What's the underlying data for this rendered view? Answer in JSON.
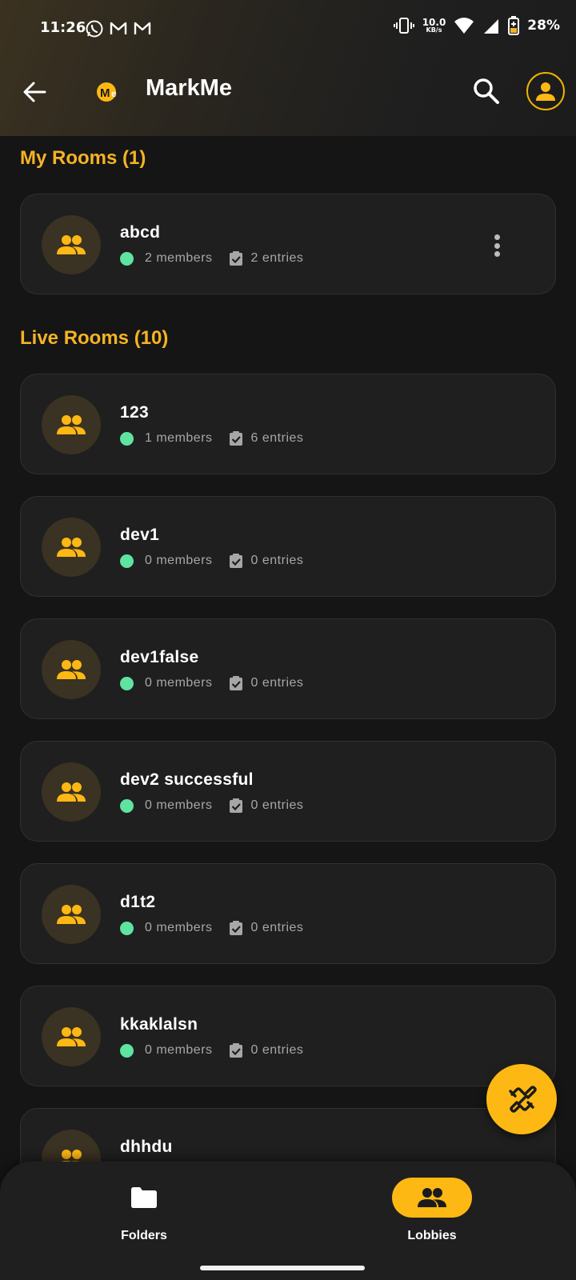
{
  "status": {
    "time": "11:26",
    "net_speed_value": "10.0",
    "net_speed_unit": "KB/s",
    "battery": "28%"
  },
  "appbar": {
    "title": "MarkMe",
    "logo_text": "Me"
  },
  "sections": {
    "my_rooms": "My Rooms (1)",
    "live_rooms": "Live Rooms (10)"
  },
  "my_rooms": [
    {
      "name": "abcd",
      "members": "2 members",
      "entries": "2 entries"
    }
  ],
  "live_rooms": [
    {
      "name": "123",
      "members": "1 members",
      "entries": "6 entries"
    },
    {
      "name": "dev1",
      "members": "0 members",
      "entries": "0 entries"
    },
    {
      "name": "dev1false",
      "members": "0 members",
      "entries": "0 entries"
    },
    {
      "name": "dev2 successful",
      "members": "0 members",
      "entries": "0 entries"
    },
    {
      "name": "d1t2",
      "members": "0 members",
      "entries": "0 entries"
    },
    {
      "name": "kkaklalsn",
      "members": "0 members",
      "entries": "0 entries"
    },
    {
      "name": "dhhdu"
    }
  ],
  "nav": {
    "folders": "Folders",
    "lobbies": "Lobbies"
  },
  "colors": {
    "accent": "#fdb813",
    "live": "#5fe3a1",
    "card_bg": "#1f1f1f",
    "background": "#151515"
  },
  "icons": {
    "back": "arrow-left-icon",
    "search": "search-icon",
    "profile": "person-icon",
    "room": "group-icon",
    "entries": "clipboard-check-icon",
    "fab": "link-icon",
    "folders": "folder-icon",
    "lobbies": "group-icon"
  }
}
